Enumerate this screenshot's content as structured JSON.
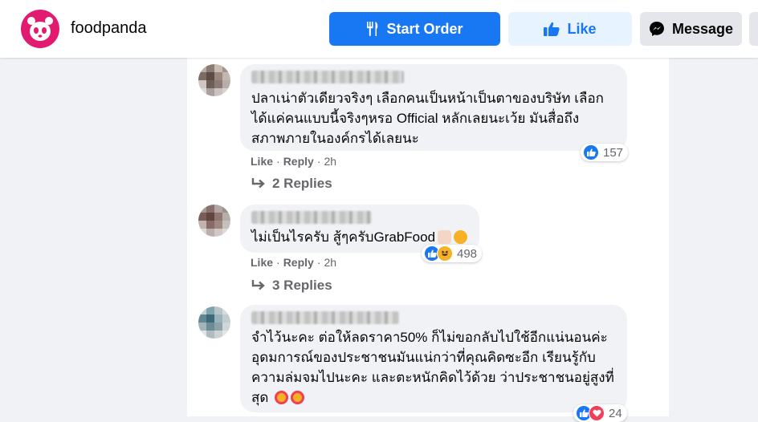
{
  "header": {
    "page_name": "foodpanda",
    "start_order": "Start Order",
    "like": "Like",
    "message": "Message"
  },
  "colors": {
    "brand": "#e21b70",
    "accent": "#1877f2",
    "love": "#f33e58",
    "haha": "#f7b125"
  },
  "comments": [
    {
      "text": "ปลาเน่าตัวเดียวจริงๆ เลือกคนเป็นหน้าเป็นตาของบริษัท เลือก\nได้แค่คนแบบนี้จริงๆหรอ Official หลักเลยนะเว้ย มันสื่อถึง\nสภาพภายในองค์กรได้เลยนะ",
      "reactions": [
        "like"
      ],
      "reaction_count": "157",
      "like": "Like",
      "reply": "Reply",
      "time": "2h",
      "replies": "2 Replies"
    },
    {
      "text": "ไม่เป็นไรครับ สู้ๆครับGrabFood",
      "reactions": [
        "like",
        "haha"
      ],
      "reaction_count": "498",
      "like": "Like",
      "reply": "Reply",
      "time": "2h",
      "replies": "3 Replies"
    },
    {
      "text": "จำไว้นะคะ ต่อให้ลดราคา50% ก็ไม่ขอกลับไปใช้อีกแน่นอนค่ะ\nอุดมการณ์ของประชาชนมันแน่กว่าที่คุณคิดซะอีก เรียนรู้กับ\nความล่มจมไปนะคะ และตะหนักคิดไว้ด้วย ว่าประชาชนอยู่สูงที่\nสุด",
      "reactions": [
        "like",
        "love"
      ],
      "reaction_count": "24"
    }
  ]
}
